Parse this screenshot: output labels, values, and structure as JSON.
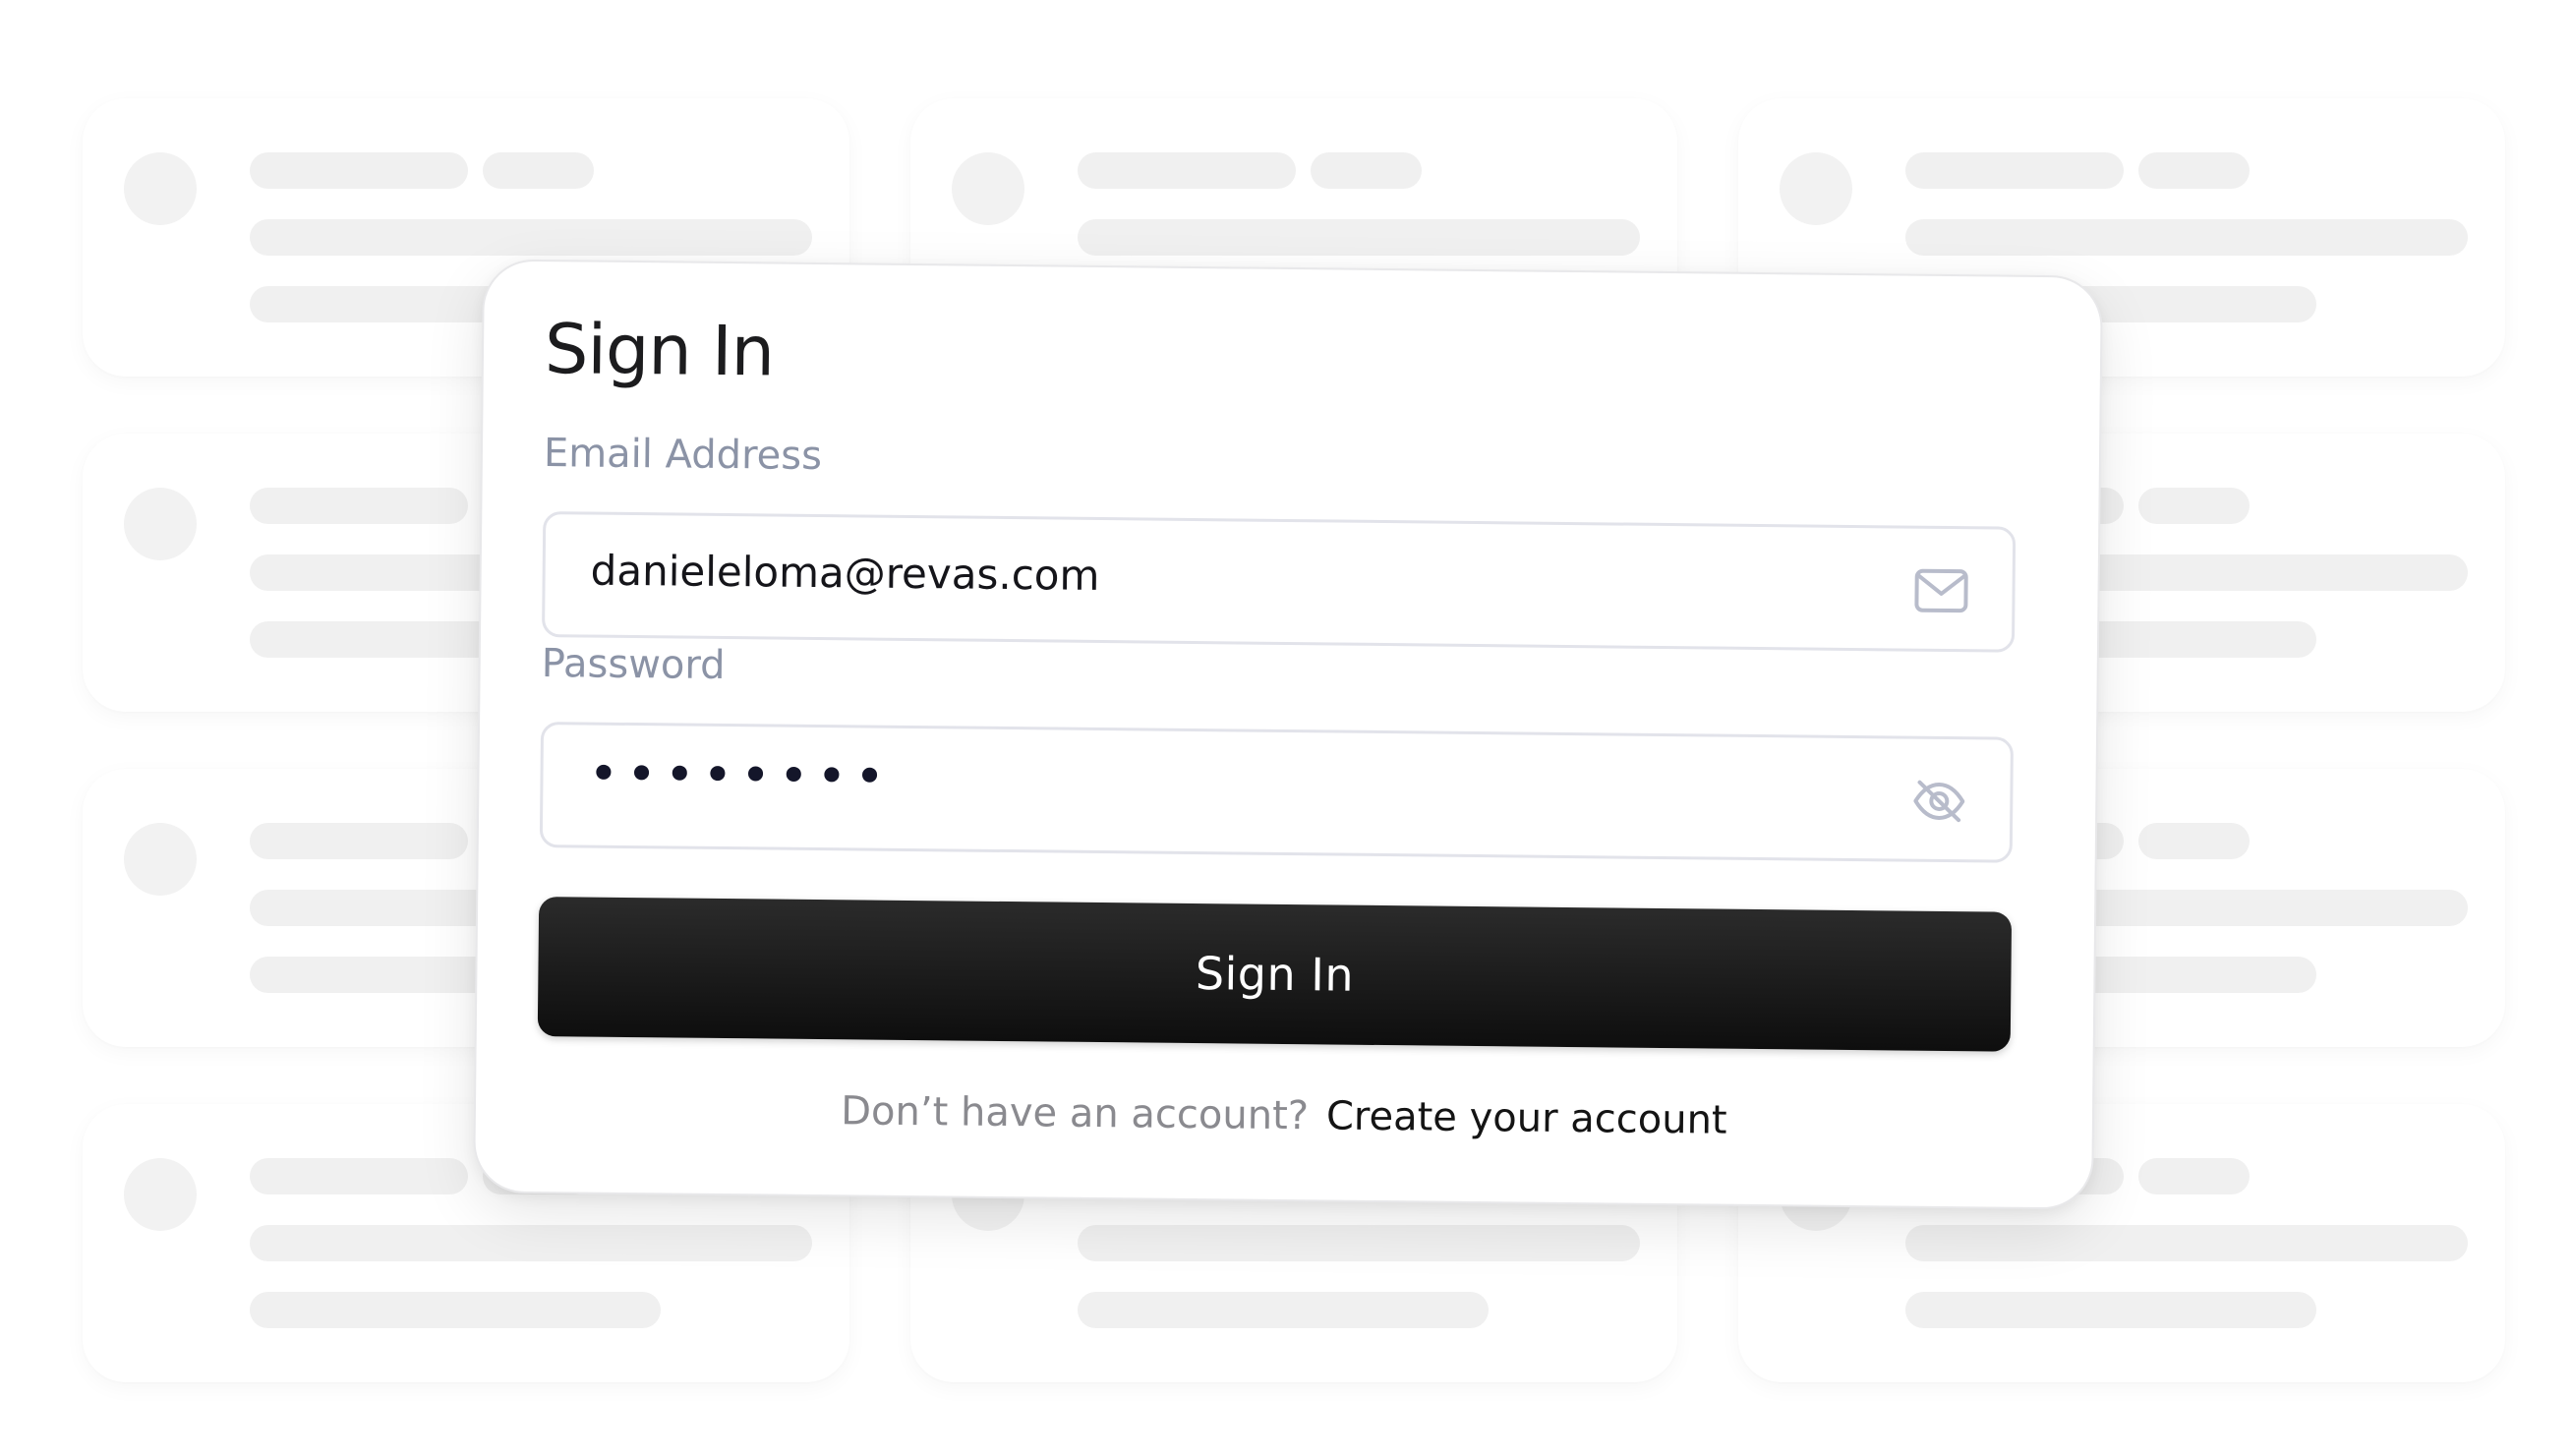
{
  "signin": {
    "title": "Sign In",
    "email_label": "Email Address",
    "email_value": "danieleloma@revas.com",
    "password_label": "Password",
    "password_value": "••••••••",
    "submit_label": "Sign In",
    "footer_prompt": "Don’t have an account?",
    "footer_link": "Create your account"
  },
  "icons": {
    "email": "mail-icon",
    "password_toggle": "eye-off-icon"
  },
  "colors": {
    "button_background": "#111111",
    "button_text": "#ffffff",
    "label_text": "#8b93a6",
    "field_border": "#e2e3ea",
    "skeleton": "#f0f0f0",
    "page_background": "#ffffff"
  }
}
